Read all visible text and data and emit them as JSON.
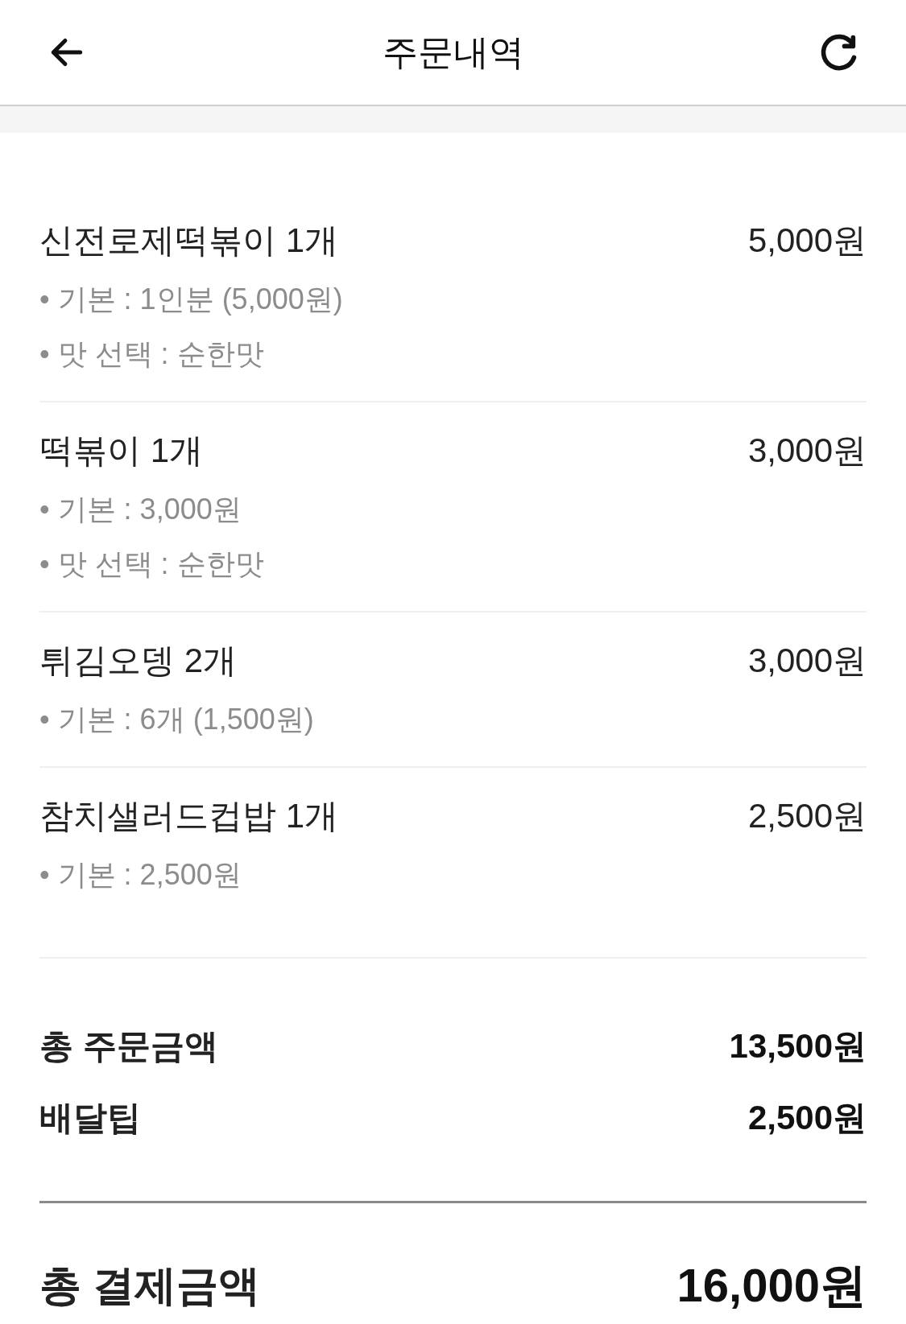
{
  "header": {
    "title": "주문내역"
  },
  "items": [
    {
      "name": "신전로제떡볶이 1개",
      "price": "5,000원",
      "options": [
        "• 기본 : 1인분 (5,000원)",
        "• 맛 선택 : 순한맛"
      ]
    },
    {
      "name": "떡볶이 1개",
      "price": "3,000원",
      "options": [
        "• 기본 : 3,000원",
        "• 맛 선택 : 순한맛"
      ]
    },
    {
      "name": "튀김오뎅 2개",
      "price": "3,000원",
      "options": [
        "• 기본 : 6개 (1,500원)"
      ]
    },
    {
      "name": "참치샐러드컵밥 1개",
      "price": "2,500원",
      "options": [
        "• 기본 : 2,500원"
      ]
    }
  ],
  "summary": [
    {
      "label": "총 주문금액",
      "value": "13,500원"
    },
    {
      "label": "배달팁",
      "value": "2,500원"
    }
  ],
  "total": {
    "label": "총 결제금액",
    "value": "16,000원"
  }
}
